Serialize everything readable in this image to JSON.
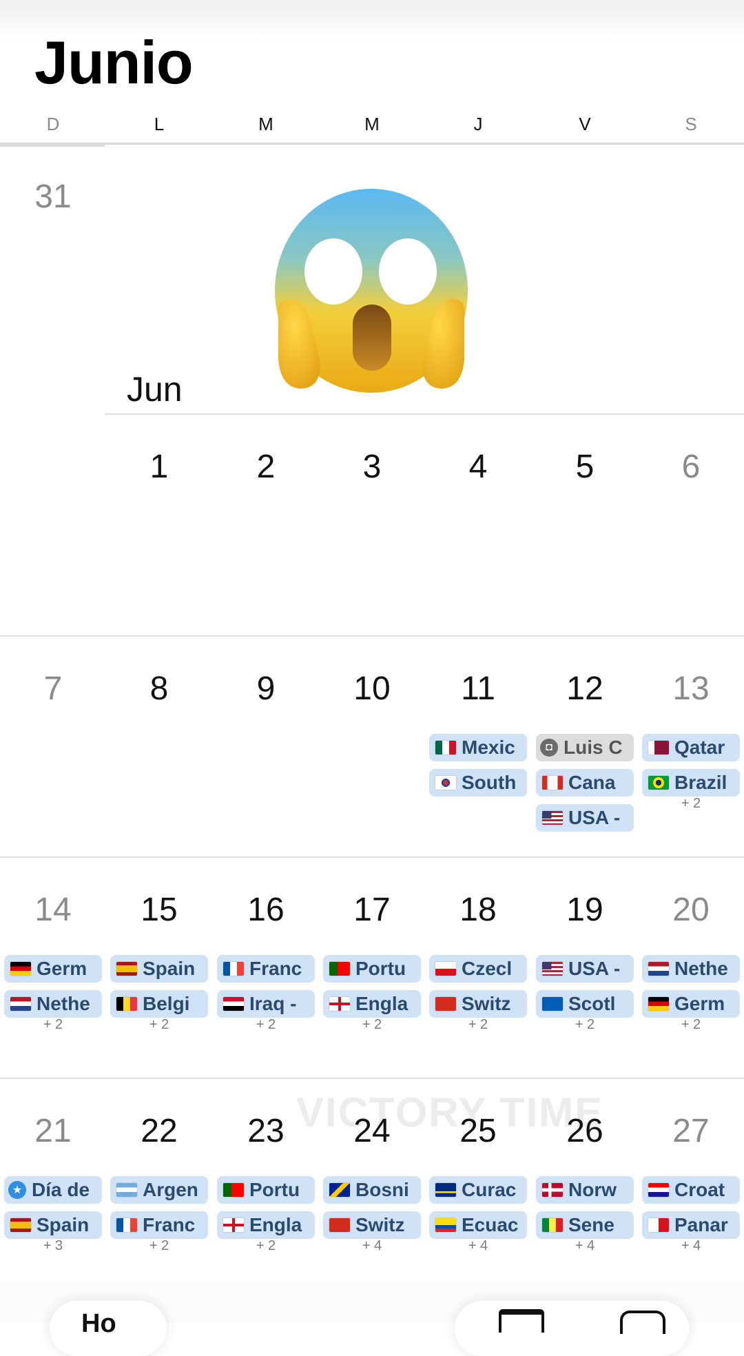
{
  "month_title": "Junio",
  "weekdays": [
    "D",
    "L",
    "M",
    "M",
    "J",
    "V",
    "S"
  ],
  "month_label": "Jun",
  "emoji": "face-screaming-in-fear",
  "watermark": "VICTORY TIME",
  "weeks": [
    {
      "days": [
        "31",
        "",
        "",
        "",
        "",
        "",
        ""
      ],
      "chips": [
        [],
        [],
        [],
        [],
        [],
        [],
        []
      ],
      "more": [
        "",
        "",
        "",
        "",
        "",
        "",
        ""
      ]
    },
    {
      "days": [
        "",
        "1",
        "2",
        "3",
        "4",
        "5",
        "6"
      ],
      "chips": [
        [],
        [],
        [],
        [],
        [],
        [],
        []
      ],
      "more": [
        "",
        "",
        "",
        "",
        "",
        "",
        ""
      ]
    },
    {
      "days": [
        "7",
        "8",
        "9",
        "10",
        "11",
        "12",
        "13"
      ],
      "chips": [
        [],
        [],
        [],
        [],
        [
          {
            "text": "Mexic",
            "flag": "mx"
          },
          {
            "text": "South",
            "flag": "kr"
          }
        ],
        [
          {
            "text": "Luis C",
            "flag": "gift",
            "style": "gray"
          },
          {
            "text": "Cana",
            "flag": "ca"
          },
          {
            "text": "USA -",
            "flag": "us"
          }
        ],
        [
          {
            "text": "Qatar",
            "flag": "qa"
          },
          {
            "text": "Brazil",
            "flag": "br"
          }
        ]
      ],
      "more": [
        "",
        "",
        "",
        "",
        "",
        "",
        "+ 2"
      ]
    },
    {
      "days": [
        "14",
        "15",
        "16",
        "17",
        "18",
        "19",
        "20"
      ],
      "chips": [
        [
          {
            "text": "Germ",
            "flag": "de"
          },
          {
            "text": "Nethe",
            "flag": "nl"
          }
        ],
        [
          {
            "text": "Spain",
            "flag": "es"
          },
          {
            "text": "Belgi",
            "flag": "be"
          }
        ],
        [
          {
            "text": "Franc",
            "flag": "fr"
          },
          {
            "text": "Iraq -",
            "flag": "iq"
          }
        ],
        [
          {
            "text": "Portu",
            "flag": "pt"
          },
          {
            "text": "Engla",
            "flag": "en"
          }
        ],
        [
          {
            "text": "Czecl",
            "flag": "cz"
          },
          {
            "text": "Switz",
            "flag": "ch"
          }
        ],
        [
          {
            "text": "USA -",
            "flag": "us"
          },
          {
            "text": "Scotl",
            "flag": "sc"
          }
        ],
        [
          {
            "text": "Nethe",
            "flag": "nl"
          },
          {
            "text": "Germ",
            "flag": "de"
          }
        ]
      ],
      "more": [
        "+ 2",
        "+ 2",
        "+ 2",
        "+ 2",
        "+ 2",
        "+ 2",
        "+ 2"
      ]
    },
    {
      "days": [
        "21",
        "22",
        "23",
        "24",
        "25",
        "26",
        "27"
      ],
      "chips": [
        [
          {
            "text": "Día de",
            "flag": "star",
            "style": "star"
          },
          {
            "text": "Spain",
            "flag": "es"
          }
        ],
        [
          {
            "text": "Argen",
            "flag": "ar"
          },
          {
            "text": "Franc",
            "flag": "fr"
          }
        ],
        [
          {
            "text": "Portu",
            "flag": "pt"
          },
          {
            "text": "Engla",
            "flag": "en"
          }
        ],
        [
          {
            "text": "Bosni",
            "flag": "ba"
          },
          {
            "text": "Switz",
            "flag": "ch"
          }
        ],
        [
          {
            "text": "Curac",
            "flag": "cw"
          },
          {
            "text": "Ecuac",
            "flag": "ec"
          }
        ],
        [
          {
            "text": "Norw",
            "flag": "no"
          },
          {
            "text": "Sene",
            "flag": "sn"
          }
        ],
        [
          {
            "text": "Croat",
            "flag": "hr"
          },
          {
            "text": "Panar",
            "flag": "pa"
          }
        ]
      ],
      "more": [
        "+ 3",
        "+ 2",
        "+ 2",
        "+ 4",
        "+ 4",
        "+ 4",
        "+ 4"
      ]
    }
  ],
  "bottom_bar": {
    "today_label": "Ho"
  }
}
